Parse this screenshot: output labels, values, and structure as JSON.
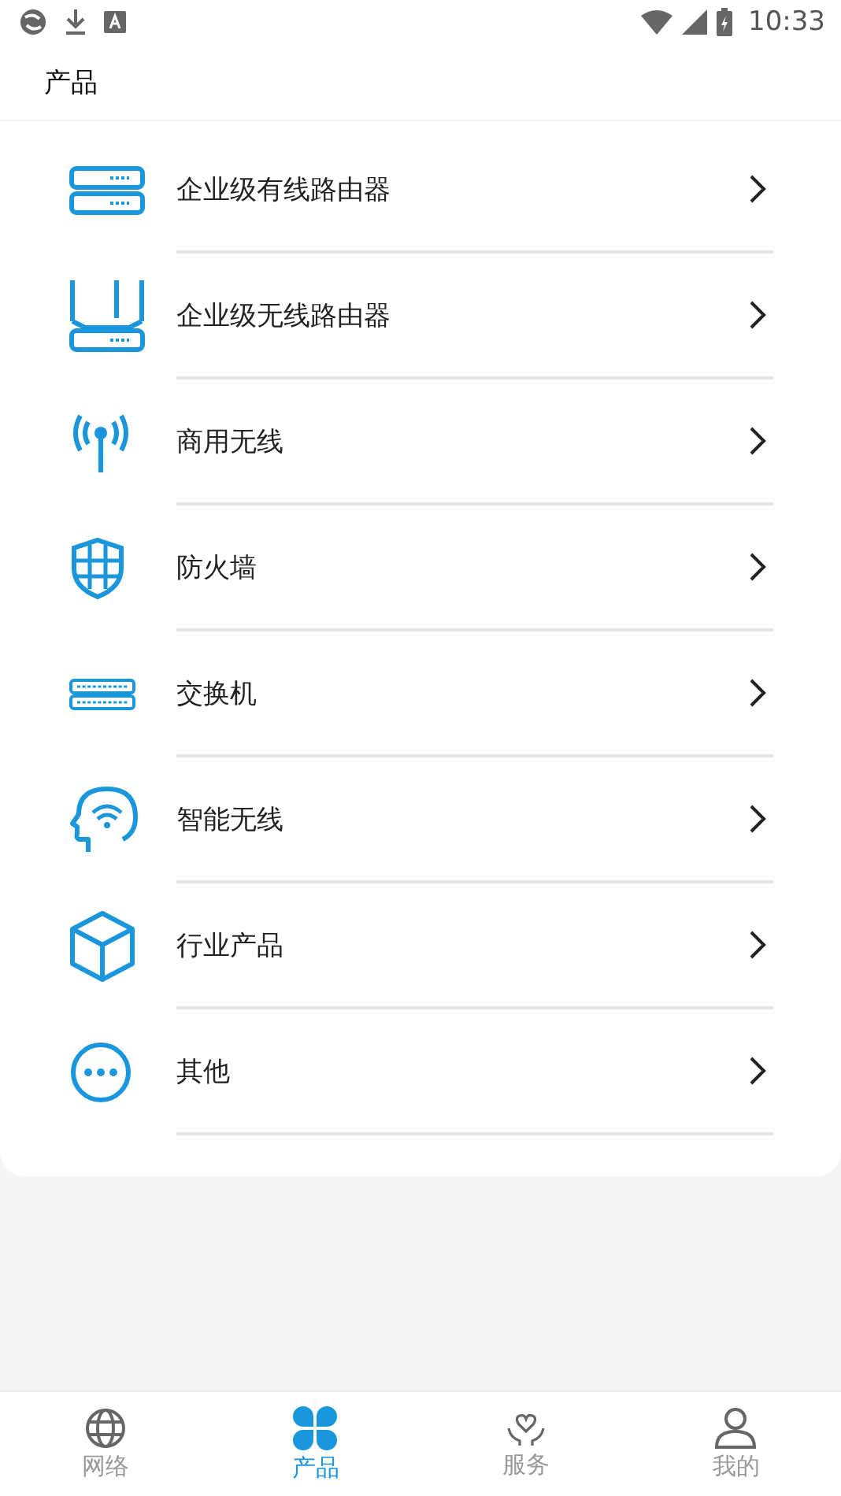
{
  "status_bar": {
    "time": "10:33"
  },
  "header": {
    "title": "产品"
  },
  "products": [
    {
      "kind": "wired-router",
      "label": "企业级有线路由器"
    },
    {
      "kind": "wireless-router",
      "label": "企业级无线路由器"
    },
    {
      "kind": "antenna",
      "label": "商用无线"
    },
    {
      "kind": "shield",
      "label": "防火墙"
    },
    {
      "kind": "switch",
      "label": "交换机"
    },
    {
      "kind": "head",
      "label": "智能无线"
    },
    {
      "kind": "cube",
      "label": "行业产品"
    },
    {
      "kind": "more",
      "label": "其他"
    }
  ],
  "tabs": [
    {
      "kind": "globe",
      "label": "网络",
      "selected": false
    },
    {
      "kind": "clover",
      "label": "产品",
      "selected": true
    },
    {
      "kind": "heart",
      "label": "服务",
      "selected": false
    },
    {
      "kind": "person",
      "label": "我的",
      "selected": false
    }
  ]
}
